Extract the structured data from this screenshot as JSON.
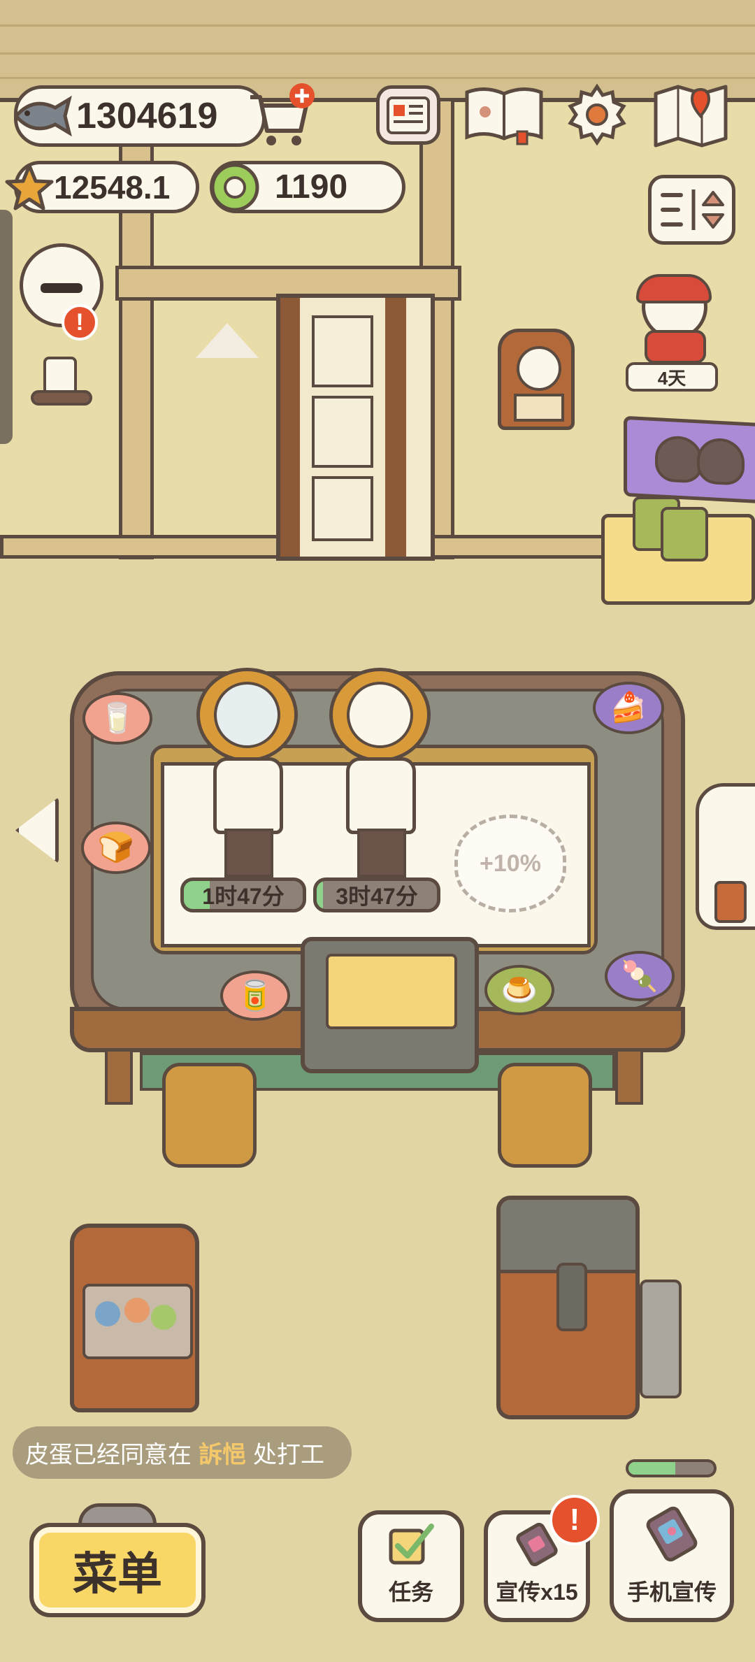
{
  "currencies": {
    "fish": "1304619",
    "stars": "12548.1",
    "rings": "1190"
  },
  "icons": {
    "fish": "fish-icon",
    "cart": "shopping-cart-plus-icon",
    "newspaper": "newspaper-icon",
    "book": "paw-book-icon",
    "settings": "gear-icon",
    "map": "map-pin-icon",
    "sort": "sort-icon",
    "star": "star-icon",
    "ring": "green-ring-icon"
  },
  "visitor": {
    "days_label": "4天"
  },
  "kitchen": {
    "chefs": [
      {
        "timer": "1时47分",
        "progress": 0.22
      },
      {
        "timer": "3时47分",
        "progress": 0.05
      }
    ],
    "bonus_slot": "+10%"
  },
  "toast": {
    "before": "皮蛋已经同意在",
    "highlight": "訴悒",
    "after": "处打工"
  },
  "bottom_bar": {
    "menu_label": "菜单",
    "tasks_label": "任务",
    "promo_label": "宣传x15",
    "phone_promo_label": "手机宣传",
    "promo_progress": 0.55
  },
  "colors": {
    "outline": "#5a4a40",
    "menu_yellow": "#f9d766",
    "alert_red": "#e4512c",
    "timer_green": "#8fd28c",
    "highlight_text": "#f4c86a"
  }
}
